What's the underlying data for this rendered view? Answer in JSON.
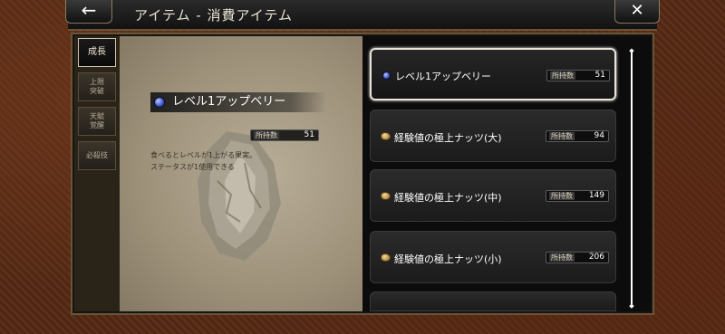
{
  "header": {
    "back_glyph": "←",
    "title": "アイテム - 消費アイテム",
    "close_glyph": "✕"
  },
  "sidebar": {
    "tabs": [
      {
        "label": "成長",
        "active": true
      },
      {
        "label": "上限\n突破",
        "active": false
      },
      {
        "label": "天賦\n覚醒",
        "active": false
      },
      {
        "label": "必殺技",
        "active": false
      }
    ]
  },
  "detail": {
    "item_name": "レベル1アップベリー",
    "icon": "berry-icon",
    "qty_label": "所持数",
    "qty_value": "51",
    "description_lines": [
      "食べるとレベルが1上がる果実。",
      "ステータスが1使用できる"
    ]
  },
  "items": [
    {
      "name": "レベル1アップベリー",
      "icon": "berry-icon",
      "qty_label": "所持数",
      "qty": "51",
      "selected": true
    },
    {
      "name": "経験値の極上ナッツ(大)",
      "icon": "nut-icon",
      "qty_label": "所持数",
      "qty": "94",
      "selected": false
    },
    {
      "name": "経験値の極上ナッツ(中)",
      "icon": "nut-icon",
      "qty_label": "所持数",
      "qty": "149",
      "selected": false
    },
    {
      "name": "経験値の極上ナッツ(小)",
      "icon": "nut-icon",
      "qty_label": "所持数",
      "qty": "206",
      "selected": false
    }
  ],
  "colors": {
    "frame_leather": "#5a2e18",
    "panel_border": "#6b5436",
    "selected_border": "#e8e4da"
  }
}
